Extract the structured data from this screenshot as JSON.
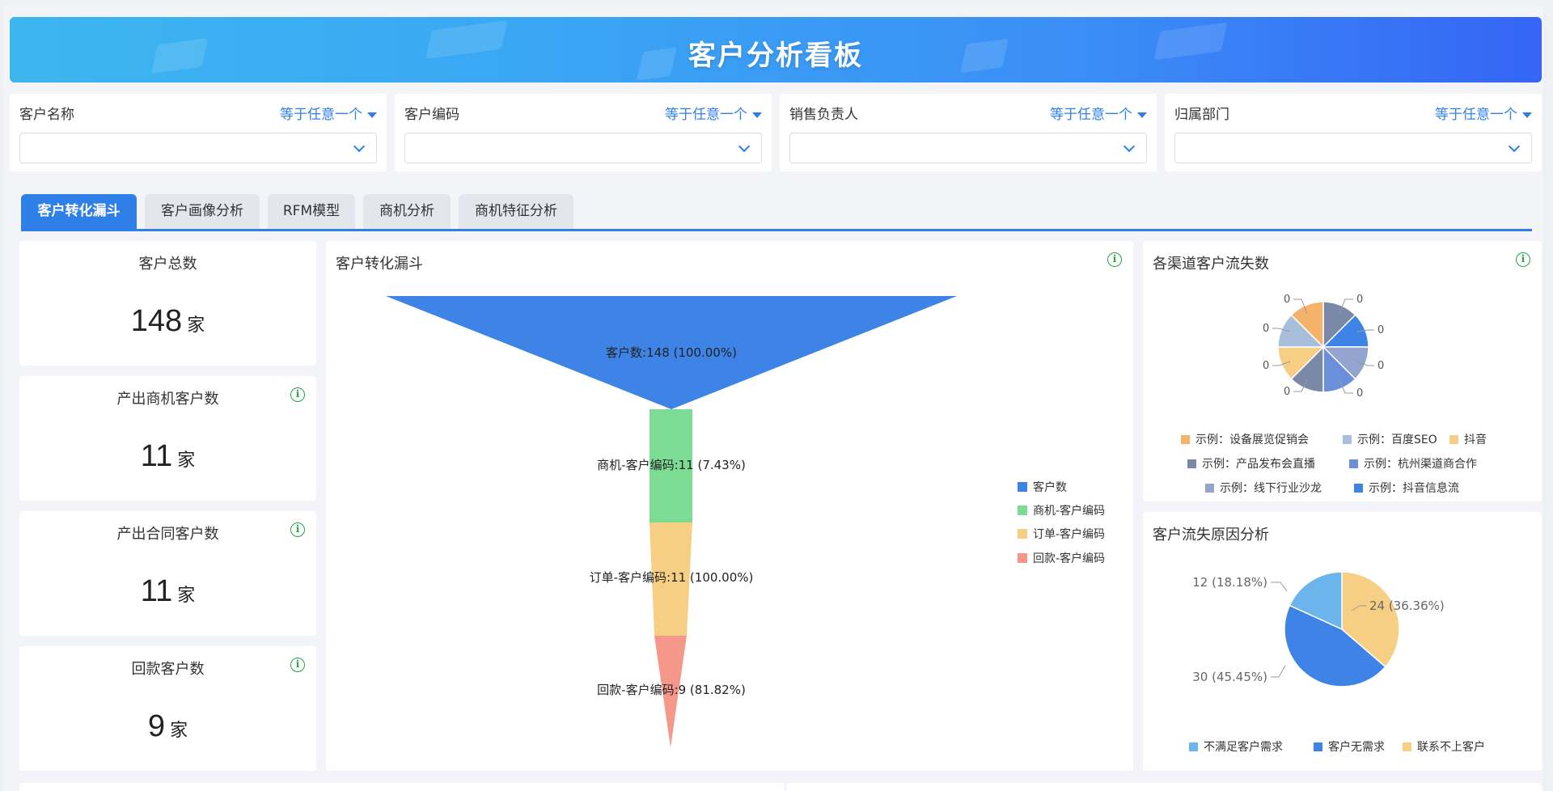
{
  "header": {
    "title": "客户分析看板"
  },
  "filters": [
    {
      "label": "客户名称",
      "mode": "等于任意一个",
      "value": ""
    },
    {
      "label": "客户编码",
      "mode": "等于任意一个",
      "value": ""
    },
    {
      "label": "销售负责人",
      "mode": "等于任意一个",
      "value": ""
    },
    {
      "label": "归属部门",
      "mode": "等于任意一个",
      "value": ""
    }
  ],
  "tabs": [
    {
      "label": "客户转化漏斗",
      "active": true
    },
    {
      "label": "客户画像分析",
      "active": false
    },
    {
      "label": "RFM模型",
      "active": false
    },
    {
      "label": "商机分析",
      "active": false
    },
    {
      "label": "商机特征分析",
      "active": false
    }
  ],
  "kpis": [
    {
      "title": "客户总数",
      "value": "148",
      "unit": "家",
      "info": false
    },
    {
      "title": "产出商机客户数",
      "value": "11",
      "unit": "家",
      "info": true
    },
    {
      "title": "产出合同客户数",
      "value": "11",
      "unit": "家",
      "info": true
    },
    {
      "title": "回款客户数",
      "value": "9",
      "unit": "家",
      "info": true
    }
  ],
  "funnel": {
    "title": "客户转化漏斗",
    "stages": [
      {
        "name": "客户数",
        "label": "客户数:148 (100.00%)",
        "color": "#3d84e6"
      },
      {
        "name": "商机-客户编码",
        "label": "商机-客户编码:11 (7.43%)",
        "color": "#7ddc94"
      },
      {
        "name": "订单-客户编码",
        "label": "订单-客户编码:11 (100.00%)",
        "color": "#f7cf84"
      },
      {
        "name": "回款-客户编码",
        "label": "回款-客户编码:9 (81.82%)",
        "color": "#f5978a"
      }
    ]
  },
  "channel_loss": {
    "title": "各渠道客户流失数",
    "slice_labels": [
      "0",
      "0",
      "0",
      "0",
      "0",
      "0",
      "0",
      "0"
    ],
    "legend": [
      {
        "name": "示例：设备展览促销会",
        "color": "#f5b26b"
      },
      {
        "name": "示例：百度SEO",
        "color": "#a8bfdc"
      },
      {
        "name": "抖音",
        "color": "#f7cf84"
      },
      {
        "name": "示例：产品发布会直播",
        "color": "#7a89a8"
      },
      {
        "name": "示例：杭州渠道商合作",
        "color": "#6c8fdc"
      },
      {
        "name": "示例：线下行业沙龙",
        "color": "#93a4cf"
      },
      {
        "name": "示例：抖音信息流",
        "color": "#3d84e6"
      }
    ]
  },
  "loss_reason": {
    "title": "客户流失原因分析",
    "slices": [
      {
        "name": "不满足客户需求",
        "value": 12,
        "label": "12 (18.18%)",
        "color": "#6cb4ec"
      },
      {
        "name": "客户无需求",
        "value": 30,
        "label": "30 (45.45%)",
        "color": "#3d84e6"
      },
      {
        "name": "联系不上客户",
        "value": 24,
        "label": "24 (36.36%)",
        "color": "#f7cf84"
      }
    ]
  }
}
